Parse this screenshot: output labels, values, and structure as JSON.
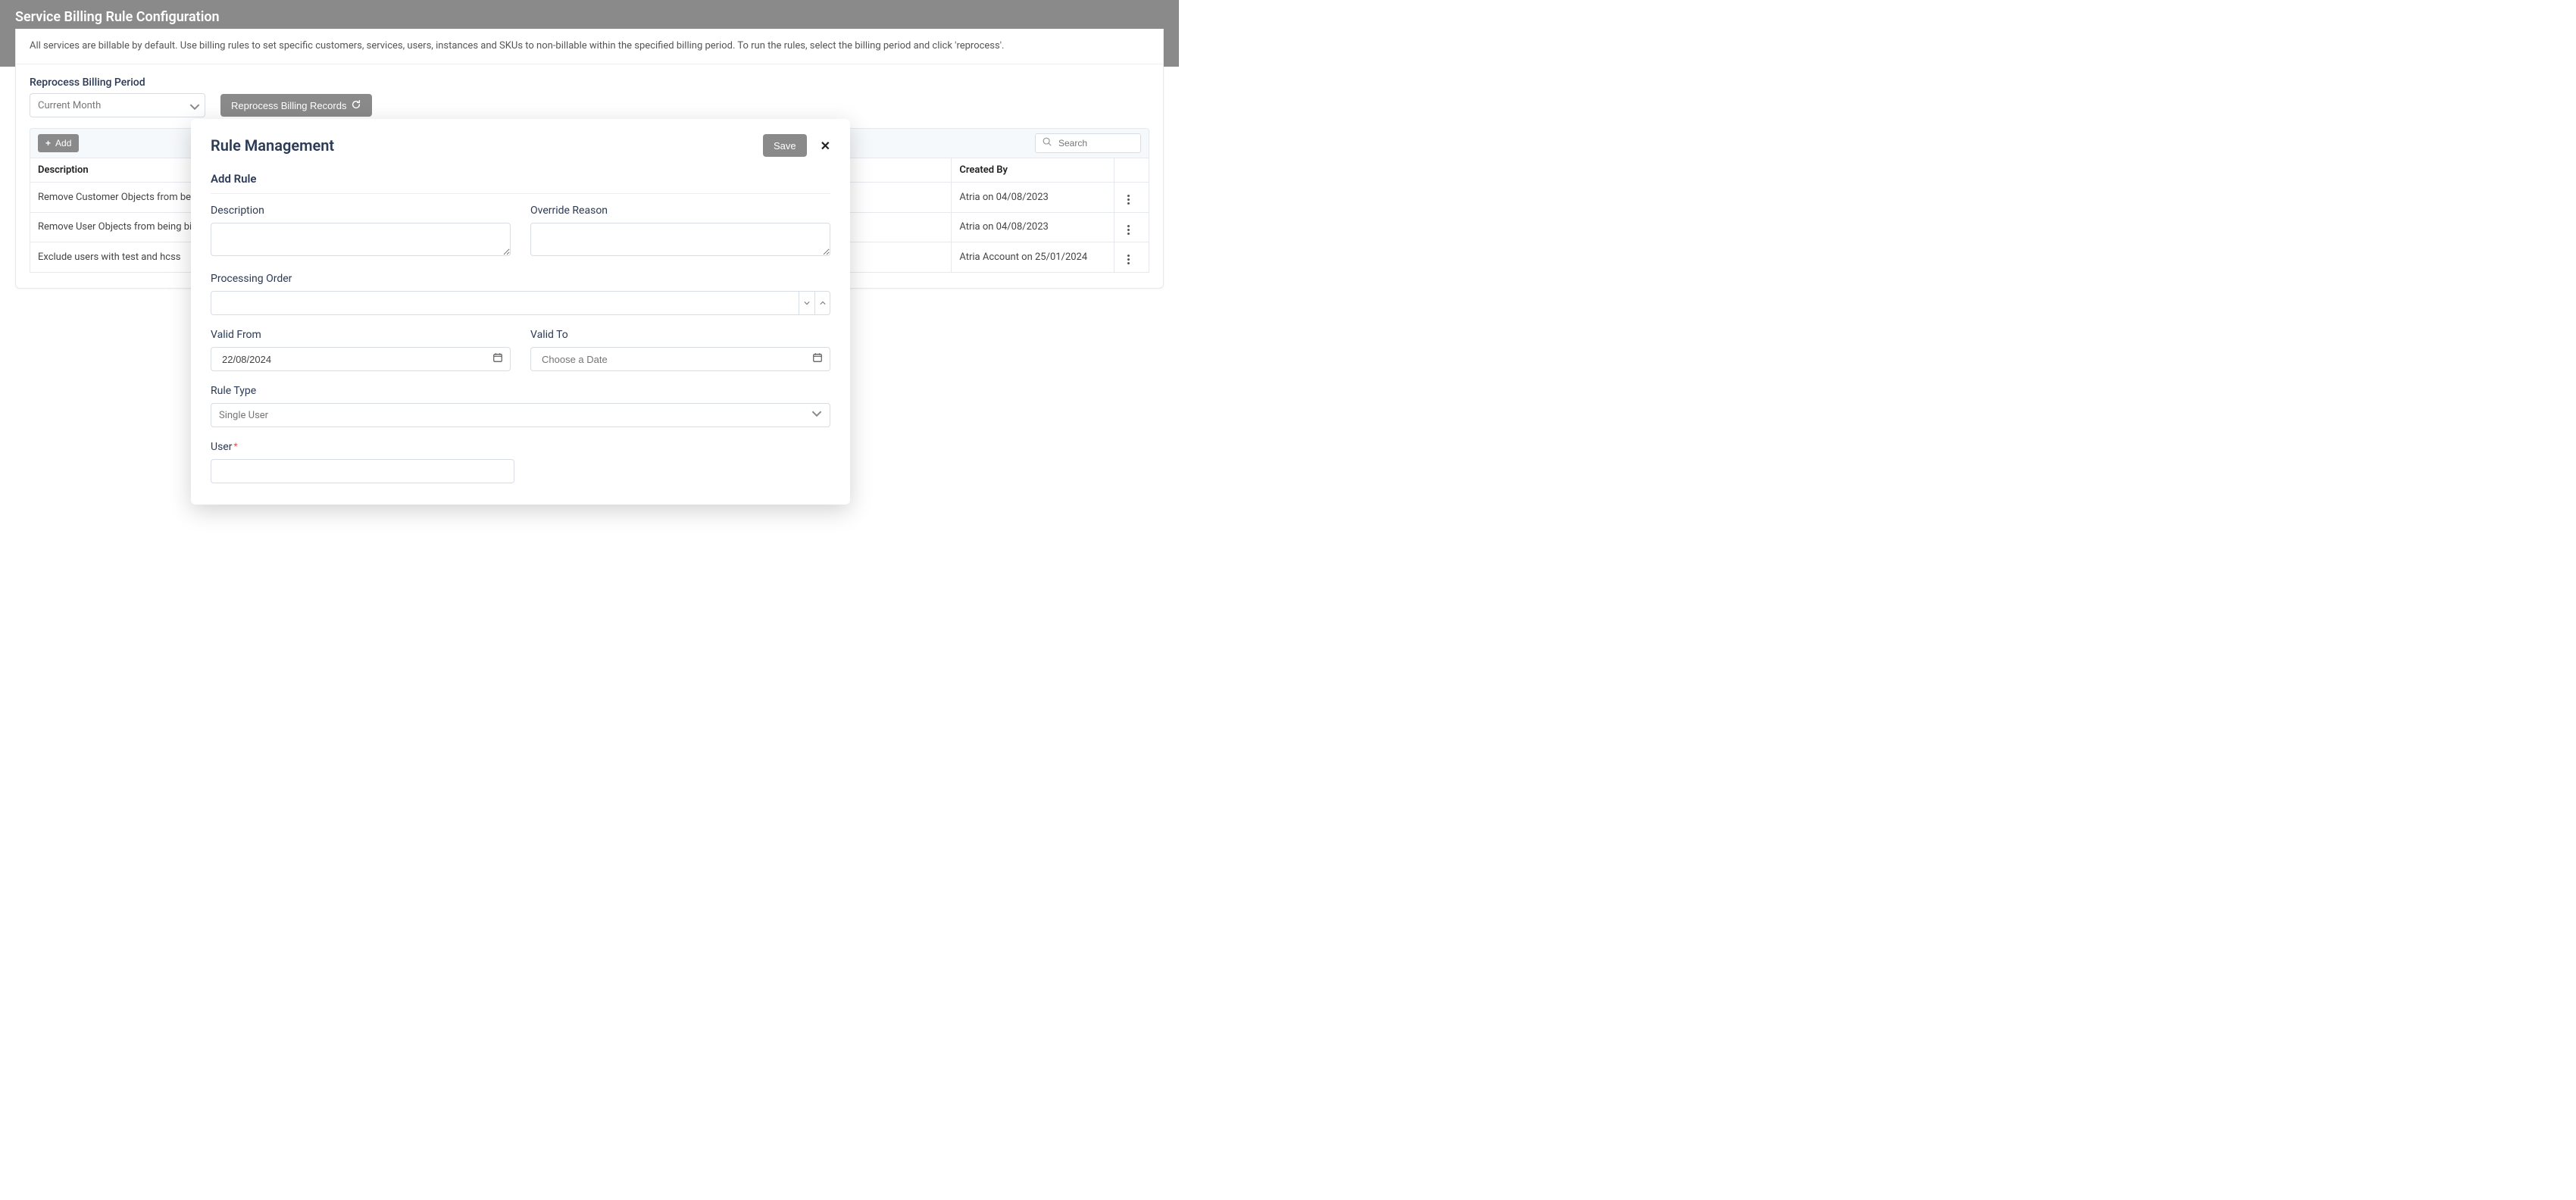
{
  "header": {
    "title": "Service Billing Rule Configuration"
  },
  "info_text": "All services are billable by default. Use billing rules to set specific customers, services, users, instances and SKUs to non-billable within the specified billing period. To run the rules, select the billing period and click 'reprocess'.",
  "reprocess": {
    "label": "Reprocess Billing Period",
    "selected": "Current Month",
    "button": "Reprocess Billing Records"
  },
  "toolbar": {
    "add_label": "Add",
    "search_placeholder": "Search"
  },
  "table": {
    "col_description": "Description",
    "col_created_by": "Created By",
    "rows": [
      {
        "description": "Remove Customer Objects from being billed",
        "created_by": "Atria on 04/08/2023"
      },
      {
        "description": "Remove User Objects from being billed",
        "created_by": "Atria on 04/08/2023"
      },
      {
        "description": "Exclude users with test and hcss",
        "created_by": "Atria Account on 25/01/2024"
      }
    ]
  },
  "modal": {
    "title": "Rule Management",
    "save_label": "Save",
    "subhead": "Add Rule",
    "fields": {
      "description_label": "Description",
      "override_label": "Override Reason",
      "processing_label": "Processing Order",
      "valid_from_label": "Valid From",
      "valid_from_value": "22/08/2024",
      "valid_to_label": "Valid To",
      "valid_to_placeholder": "Choose a Date",
      "rule_type_label": "Rule Type",
      "rule_type_value": "Single User",
      "user_label": "User"
    }
  }
}
